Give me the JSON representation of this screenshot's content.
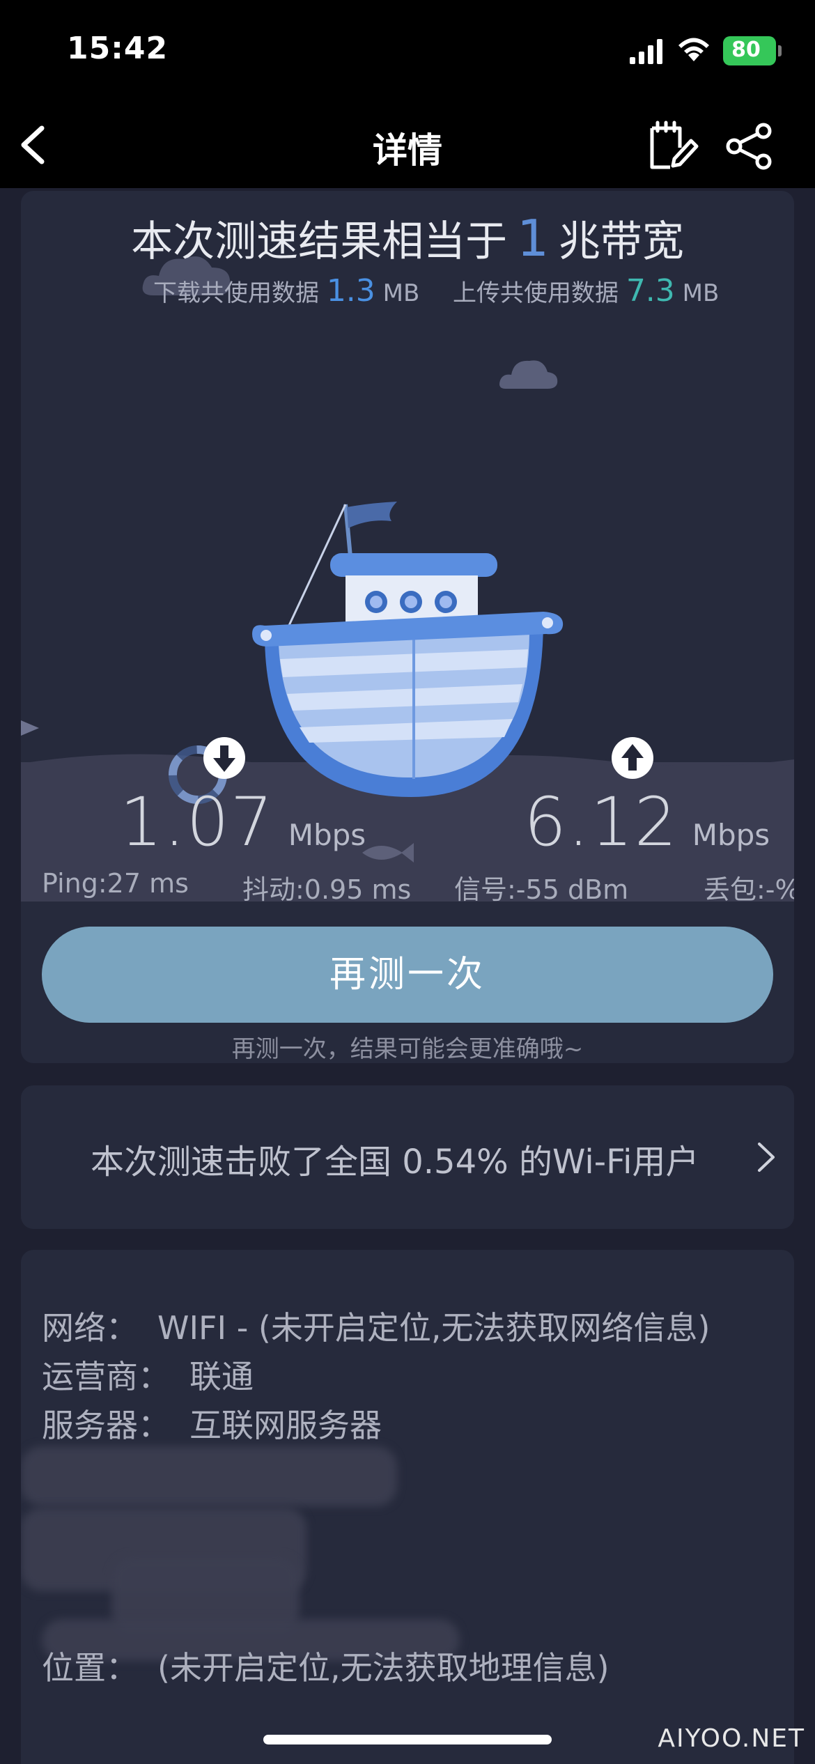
{
  "status_bar": {
    "time": "15:42",
    "battery": "80"
  },
  "nav": {
    "title": "详情"
  },
  "result": {
    "headline_prefix": "本次测速结果相当于",
    "headline_value": "1",
    "headline_suffix": "兆带宽",
    "download_used_label": "下载共使用数据",
    "download_used_value": "1.3",
    "download_used_unit": "MB",
    "upload_used_label": "上传共使用数据",
    "upload_used_value": "7.3",
    "upload_used_unit": "MB",
    "download_speed": "1.07",
    "download_unit": "Mbps",
    "upload_speed": "6.12",
    "upload_unit": "Mbps",
    "ping": "Ping:27 ms",
    "jitter": "抖动:0.95 ms",
    "signal": "信号:-55 dBm",
    "packet_loss": "丢包:-%",
    "retest_label": "再测一次",
    "retest_hint": "再测一次，结果可能会更准确哦~"
  },
  "rank": {
    "text": "本次测速击败了全国 0.54% 的Wi-Fi用户"
  },
  "info": {
    "network_label": "网络：",
    "network_value": "WIFI -  (未开启定位,无法获取网络信息)",
    "carrier_label": "运营商：",
    "carrier_value": "联通",
    "server_label": "服务器：",
    "server_value": "互联网服务器",
    "location_label": "位置：",
    "location_value": "(未开启定位,无法获取地理信息)"
  },
  "watermark": "AIYOO.NET",
  "colors": {
    "background": "#1e2030",
    "card": "#262a3c",
    "retest_button": "#7aa4bf",
    "download_accent": "#4a90e2",
    "upload_accent": "#3fb8b0",
    "battery": "#35c759"
  },
  "icons": [
    "back-icon",
    "edit-note-icon",
    "share-icon",
    "download-arrow-icon",
    "upload-arrow-icon",
    "chevron-right-icon"
  ]
}
